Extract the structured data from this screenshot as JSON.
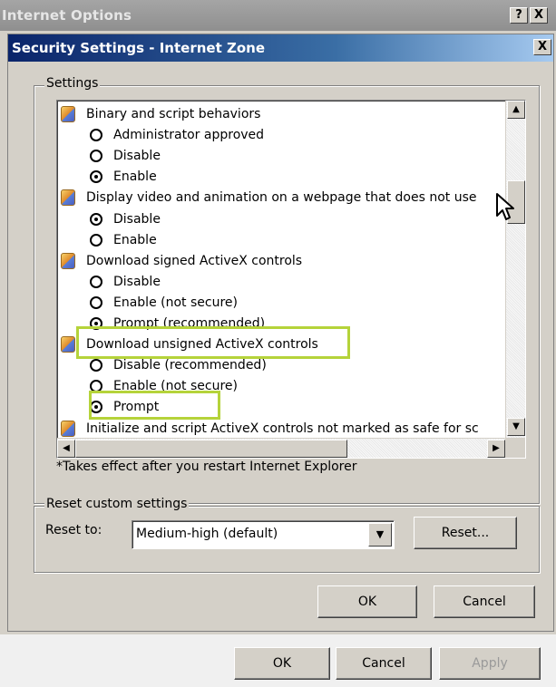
{
  "outer": {
    "title": "Internet Options",
    "help_label": "?",
    "close_label": "X",
    "buttons": {
      "ok": "OK",
      "cancel": "Cancel",
      "apply": "Apply"
    }
  },
  "dialog": {
    "title": "Security Settings - Internet Zone",
    "close_label": "X",
    "settings_group_label": "Settings",
    "footnote": "*Takes effect after you restart Internet Explorer",
    "reset_group_label": "Reset custom settings",
    "reset_to_label": "Reset to:",
    "reset_select_value": "Medium-high (default)",
    "reset_button": "Reset...",
    "ok_button": "OK",
    "cancel_button": "Cancel"
  },
  "settings": [
    {
      "type": "category",
      "label": "Binary and script behaviors"
    },
    {
      "type": "option",
      "label": "Administrator approved",
      "selected": false
    },
    {
      "type": "option",
      "label": "Disable",
      "selected": false
    },
    {
      "type": "option",
      "label": "Enable",
      "selected": true
    },
    {
      "type": "category",
      "label": "Display video and animation on a webpage that does not use"
    },
    {
      "type": "option",
      "label": "Disable",
      "selected": true
    },
    {
      "type": "option",
      "label": "Enable",
      "selected": false
    },
    {
      "type": "category",
      "label": "Download signed ActiveX controls"
    },
    {
      "type": "option",
      "label": "Disable",
      "selected": false
    },
    {
      "type": "option",
      "label": "Enable (not secure)",
      "selected": false
    },
    {
      "type": "option",
      "label": "Prompt (recommended)",
      "selected": true
    },
    {
      "type": "category",
      "label": "Download unsigned ActiveX controls"
    },
    {
      "type": "option",
      "label": "Disable (recommended)",
      "selected": false
    },
    {
      "type": "option",
      "label": "Enable (not secure)",
      "selected": false
    },
    {
      "type": "option",
      "label": "Prompt",
      "selected": true
    },
    {
      "type": "category",
      "label": "Initialize and script ActiveX controls not marked as safe for sc"
    }
  ],
  "highlights": [
    "Download unsigned ActiveX controls",
    "Prompt"
  ],
  "colors": {
    "highlight": "#b5d33a",
    "title_bar": "#0a246a"
  }
}
